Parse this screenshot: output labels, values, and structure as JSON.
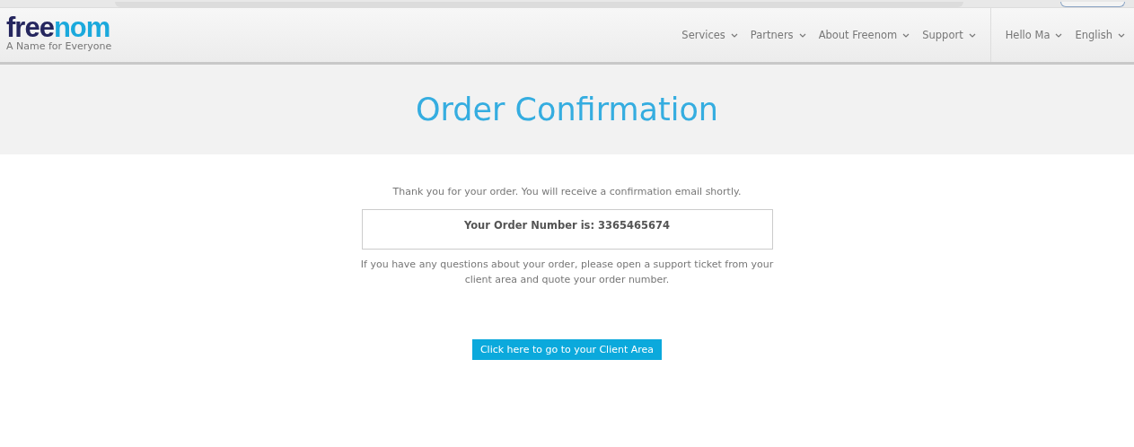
{
  "logo": {
    "dark_part": "free",
    "light_part": "nom",
    "tagline": "A Name for Everyone"
  },
  "nav": [
    {
      "label": "Services"
    },
    {
      "label": "Partners"
    },
    {
      "label": "About Freenom"
    },
    {
      "label": "Support"
    }
  ],
  "user_nav": [
    {
      "label": "Hello Ma"
    },
    {
      "label": "English"
    }
  ],
  "page_title": "Order Confirmation",
  "thanks": "Thank you for your order. You will receive a confirmation email shortly.",
  "order_number": "Your Order Number is: 3365465674",
  "questions": "If you have any questions about your order, please open a support ticket from your client area and quote your order number.",
  "client_area_button": "Click here to go to your Client Area"
}
